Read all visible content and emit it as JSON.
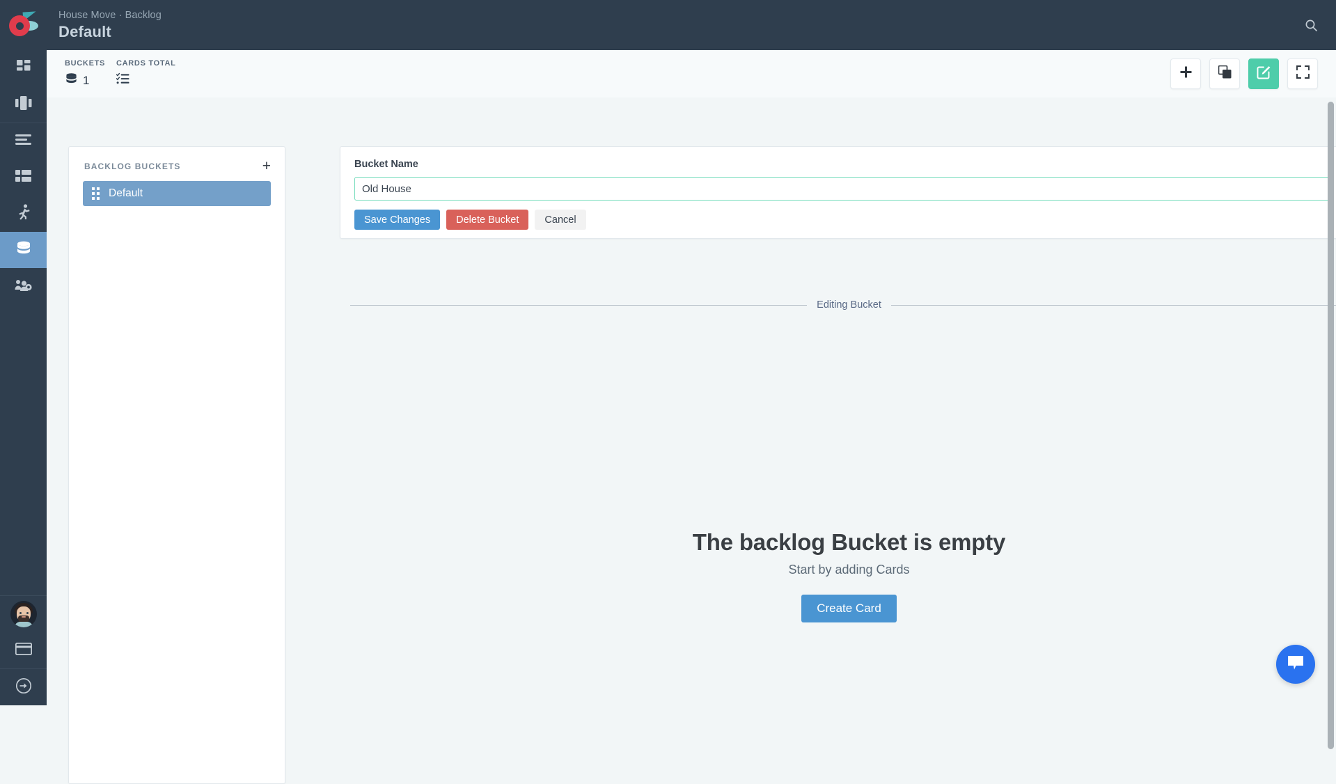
{
  "header": {
    "breadcrumb": "House Move · Backlog",
    "title": "Default",
    "search_icon": "search-icon",
    "logo_icon": "app-logo-icon",
    "bg_color": "#2f3e4e"
  },
  "sidebar": {
    "items": [
      {
        "name": "dashboard",
        "icon": "grid-dashboard-icon",
        "active": false
      },
      {
        "name": "board",
        "icon": "columns-board-icon",
        "active": false
      },
      {
        "name": "backlog-list",
        "icon": "list-lines-icon",
        "active": false
      },
      {
        "name": "table",
        "icon": "table-grid-icon",
        "active": false
      },
      {
        "name": "sprint",
        "icon": "running-person-icon",
        "active": false
      },
      {
        "name": "buckets",
        "icon": "database-stack-icon",
        "active": true
      },
      {
        "name": "team-settings",
        "icon": "people-gear-icon",
        "active": false
      }
    ],
    "bottom_items": [
      {
        "name": "user-avatar",
        "icon": "avatar-icon"
      },
      {
        "name": "billing",
        "icon": "credit-card-icon"
      },
      {
        "name": "logout",
        "icon": "arrow-circle-right-icon"
      }
    ],
    "active_color": "#6c9bc8"
  },
  "stats": {
    "buckets_label": "BUCKETS",
    "buckets_value": "1",
    "buckets_icon": "database-stack-icon",
    "cards_label": "CARDS TOTAL",
    "cards_value": "",
    "cards_icon": "checklist-icon"
  },
  "toolbar": {
    "buttons": [
      {
        "name": "add-button",
        "icon": "plus-icon",
        "accent": false
      },
      {
        "name": "duplicate-button",
        "icon": "copy-layers-icon",
        "accent": false
      },
      {
        "name": "edit-button",
        "icon": "pencil-square-icon",
        "accent": true
      },
      {
        "name": "fullscreen-button",
        "icon": "expand-corners-icon",
        "accent": false
      }
    ],
    "accent_color": "#4ecdaa"
  },
  "buckets_panel": {
    "title": "BACKLOG BUCKETS",
    "add_icon": "plus-icon",
    "items": [
      {
        "label": "Default",
        "selected": true,
        "handle_icon": "drag-handle-icon"
      }
    ],
    "selected_color": "#74a0c9"
  },
  "editor": {
    "field_label": "Bucket Name",
    "input_value": "Old House",
    "input_placeholder": "Bucket Name",
    "input_border_color": "#76dcbc",
    "save_label": "Save Changes",
    "delete_label": "Delete Bucket",
    "cancel_label": "Cancel",
    "save_color": "#4a95d2",
    "delete_color": "#d9615a"
  },
  "divider": {
    "text": "Editing Bucket"
  },
  "empty_state": {
    "title": "The backlog Bucket is empty",
    "subtitle": "Start by adding Cards",
    "button_label": "Create Card"
  },
  "chat": {
    "icon": "chat-bubble-icon",
    "color": "#2a72ef"
  }
}
